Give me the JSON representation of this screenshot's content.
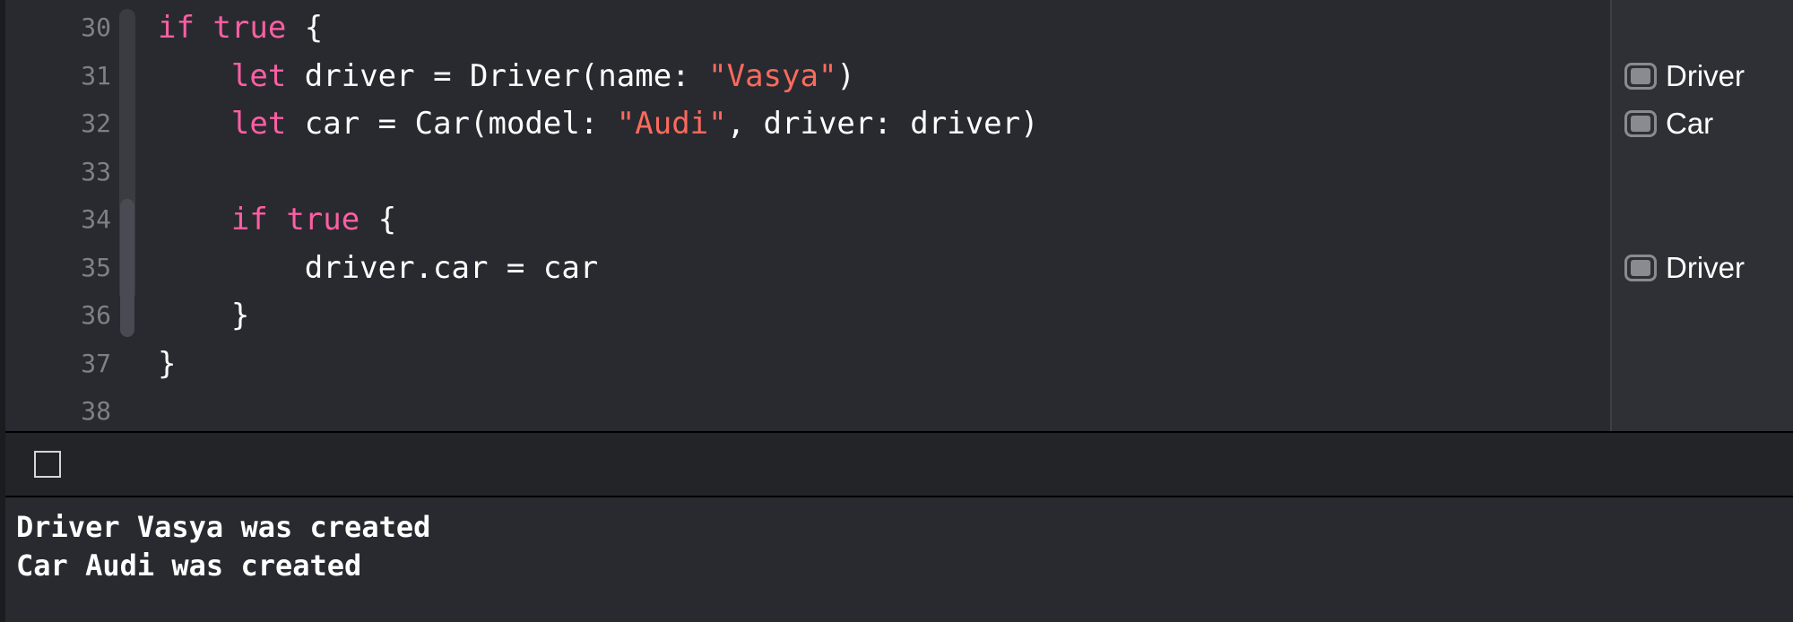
{
  "editor": {
    "lines": [
      {
        "number": "30",
        "indent": "",
        "tokens": [
          {
            "t": "if",
            "k": "kw"
          },
          {
            "t": " ",
            "k": "plain"
          },
          {
            "t": "true",
            "k": "kw"
          },
          {
            "t": " {",
            "k": "plain"
          }
        ]
      },
      {
        "number": "31",
        "indent": "    ",
        "tokens": [
          {
            "t": "let",
            "k": "kw"
          },
          {
            "t": " driver = Driver(name: ",
            "k": "plain"
          },
          {
            "t": "\"Vasya\"",
            "k": "str"
          },
          {
            "t": ")",
            "k": "plain"
          }
        ]
      },
      {
        "number": "32",
        "indent": "    ",
        "tokens": [
          {
            "t": "let",
            "k": "kw"
          },
          {
            "t": " car = Car(model: ",
            "k": "plain"
          },
          {
            "t": "\"Audi\"",
            "k": "str"
          },
          {
            "t": ", driver: driver)",
            "k": "plain"
          }
        ]
      },
      {
        "number": "33",
        "indent": "",
        "tokens": []
      },
      {
        "number": "34",
        "indent": "    ",
        "tokens": [
          {
            "t": "if",
            "k": "kw"
          },
          {
            "t": " ",
            "k": "plain"
          },
          {
            "t": "true",
            "k": "kw"
          },
          {
            "t": " {",
            "k": "plain"
          }
        ]
      },
      {
        "number": "35",
        "indent": "        ",
        "tokens": [
          {
            "t": "driver.car = car",
            "k": "plain"
          }
        ]
      },
      {
        "number": "36",
        "indent": "    ",
        "tokens": [
          {
            "t": "}",
            "k": "plain"
          }
        ]
      },
      {
        "number": "37",
        "indent": "",
        "tokens": [
          {
            "t": "}",
            "k": "plain"
          }
        ]
      },
      {
        "number": "38",
        "indent": "",
        "tokens": []
      }
    ]
  },
  "results": [
    {
      "line": "31",
      "label": "Driver",
      "icon": "result-preview-icon"
    },
    {
      "line": "32",
      "label": "Car",
      "icon": "result-preview-icon"
    },
    {
      "line": "35",
      "label": "Driver",
      "icon": "result-preview-icon"
    }
  ],
  "debug_bar": {
    "toggle_icon": "checkbox-icon"
  },
  "console": {
    "lines": [
      "Driver Vasya was created",
      "Car Audi was created"
    ]
  },
  "colors": {
    "background": "#292a30",
    "keyword": "#fc5fa3",
    "string": "#fc6a5d",
    "text": "#ffffff",
    "line_number": "#7f8084"
  }
}
